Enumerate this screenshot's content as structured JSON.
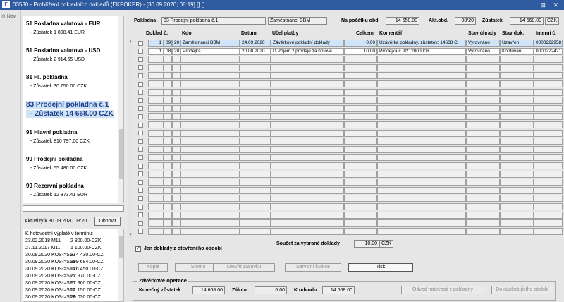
{
  "window": {
    "app_icon": "F",
    "title": "03530 - Prohlížení pokladních dokladů (EKPOKPR) - [30.09.2020; 08:19] [] []",
    "controls": "⊟ ✕"
  },
  "nav": {
    "label": "Nav"
  },
  "registers": [
    {
      "name": "51 Pokladna valutová - EUR",
      "balance": "- Zůstatek 1 808.41 EUR"
    },
    {
      "name": "51 Pokladna valutová - USD",
      "balance": "- Zůstatek 2 914.65 USD"
    },
    {
      "name": "81 Hl. pokladna",
      "balance": "- Zůstatek 30 750.00 CZK"
    },
    {
      "name": "83 Prodejní pokladna č.1",
      "balance": "- Zůstatek 14 668.00 CZK",
      "selected": true
    },
    {
      "name": "91 Hlavní pokladna",
      "balance": "- Zůstatek 810 797.00 CZK"
    },
    {
      "name": "99 Prodejní pokladna",
      "balance": "- Zůstatek 55 480.00 CZK"
    },
    {
      "name": "99 Rezervní pokladna",
      "balance": "- Zůstatek 12 873.41 EUR"
    }
  ],
  "actuality": {
    "label": "Aktuality k 30.09.2020 08:20",
    "refresh": "Obnovit"
  },
  "payouts": {
    "heading": "K hotovostní výplatě v termínu:",
    "rows": [
      [
        "23.02.2018 M11",
        "2 800.00-CZK"
      ],
      [
        "27.11.2017 M11",
        "1 100.00-CZK"
      ],
      [
        "30.09.2020 KOS->S12",
        "374 430.00-CZ"
      ],
      [
        "30.09.2020 KOS->S13",
        "399 684.00-CZ"
      ],
      [
        "30.09.2020 KOS->S14",
        "126 450.00-CZ"
      ],
      [
        "30.09.2020 KOS->S15",
        "72 970.00-CZ"
      ],
      [
        "30.09.2020 KOS->S16",
        "97 960.00-CZ"
      ],
      [
        "30.09.2020 KOS->S17",
        "12 150.00-CZ"
      ],
      [
        "30.09.2020 KOS->S18",
        "20 030.00-CZ"
      ]
    ]
  },
  "header": {
    "pokladna_label": "Pokladna",
    "pokladna_value": "83 Prodejní pokladna č.1",
    "pokladna_desc": "Zaměstnanci BBM",
    "start_label": "Na počátku obd.",
    "start_value": "14 658.00",
    "period_label": "Akt.obd.",
    "period_value": "08/20",
    "balance_label": "Zůstatek",
    "balance_value": "14 668.00",
    "currency": "CZK"
  },
  "grid": {
    "columns": [
      "Doklad č.",
      "Kdo",
      "Datum",
      "Účel platby",
      "Celkem",
      "Komentář",
      "Stav úhrady",
      "Stav dok.",
      "Interní č."
    ],
    "rows": [
      [
        "1",
        "09",
        "20",
        "Zaměstnanci BBM",
        "24.09.2020",
        "Závěrkové pokladní doklady",
        "0.00",
        "Uzávěrka pokladny, zůstatek: 14668 C",
        "Vyrovnáno",
        "Uzavřen",
        "0000222958"
      ],
      [
        "1",
        "08",
        "20",
        "Prodejka",
        "20.08.2020",
        "D Příjem z prodeje za hotové",
        "10.00",
        "Prodejka č.:8212000006",
        "Vyrovnáno",
        "Kontován",
        "0000222421"
      ]
    ]
  },
  "filter": {
    "label": "Jen doklady z otevřeného období",
    "checkmark": "✓"
  },
  "sum": {
    "label": "Součet za vybrané doklady",
    "value": "10.00",
    "currency": "CZK"
  },
  "buttons": [
    "Kopie",
    "Storno",
    "Otevřít zásuvku",
    "Servisní funkce",
    "Tisk"
  ],
  "closing": {
    "title": "Závěrkové operace",
    "final_label": "Konečný zůstatek",
    "final_value": "14 668.00",
    "advance_label": "Záloha",
    "advance_value": "0.00",
    "transfer_label": "K odvodu",
    "transfer_value": "14 668.00",
    "btn_transfer": "Odvod hotovosti z pokladny",
    "btn_next": "Do následujícího období"
  }
}
